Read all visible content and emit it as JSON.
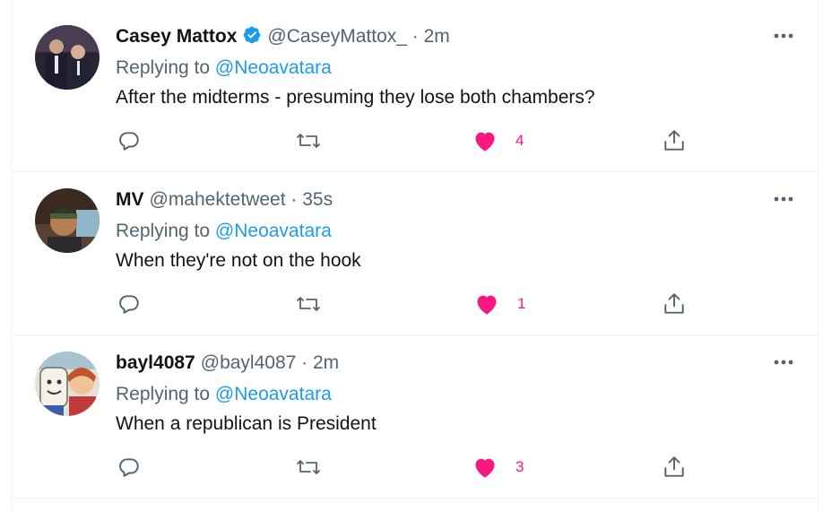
{
  "tweets": [
    {
      "display_name": "Casey Mattox",
      "verified": true,
      "handle": "@CaseyMattox_",
      "time": "· 2m",
      "replying_prefix": "Replying to",
      "replying_to": "@Neoavatara",
      "text": "After the midterms - presuming they lose both chambers?",
      "likes": "4",
      "liked": true
    },
    {
      "display_name": "MV",
      "verified": false,
      "handle": "@mahektetweet",
      "time": "· 35s",
      "replying_prefix": "Replying to",
      "replying_to": "@Neoavatara",
      "text": "When they're not on the hook",
      "likes": "1",
      "liked": true
    },
    {
      "display_name": "bayl4087",
      "verified": false,
      "handle": "@bayl4087",
      "time": "· 2m",
      "replying_prefix": "Replying to",
      "replying_to": "@Neoavatara",
      "text": "When a republican is President",
      "likes": "3",
      "liked": true
    }
  ],
  "colors": {
    "text_primary": "#0f1419",
    "text_secondary": "#536471",
    "accent_blue": "#1d9bf0",
    "like_pink": "#f91880",
    "divider": "#eff3f4"
  }
}
